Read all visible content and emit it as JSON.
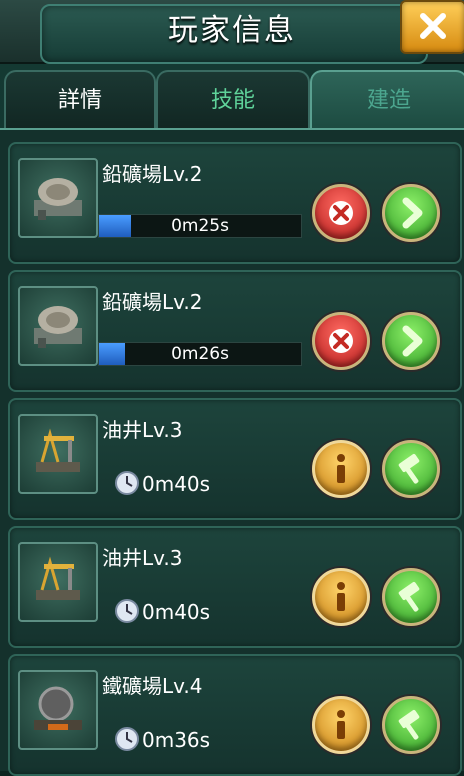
{
  "header": {
    "title": "玩家信息"
  },
  "tabs": [
    {
      "label": "詳情"
    },
    {
      "label": "技能"
    },
    {
      "label": "建造"
    }
  ],
  "colors": {
    "accent_gold": "#f5b02b",
    "progress_blue": "#2f7fe8",
    "cancel_red": "#d43a32",
    "confirm_green": "#4ec23a"
  },
  "buildings": [
    {
      "name": "鉛礦場Lv.2",
      "time": "0m25s",
      "progress": 0.16,
      "icon": "mine-machine-icon",
      "actions": [
        "cancel-icon",
        "speed-up-icon"
      ]
    },
    {
      "name": "鉛礦場Lv.2",
      "time": "0m26s",
      "progress": 0.13,
      "icon": "mine-machine-icon",
      "actions": [
        "cancel-icon",
        "speed-up-icon"
      ]
    },
    {
      "name": "油井Lv.3",
      "time": "0m40s",
      "icon": "oil-well-icon",
      "actions": [
        "info-icon",
        "build-hammer-icon"
      ]
    },
    {
      "name": "油井Lv.3",
      "time": "0m40s",
      "icon": "oil-well-icon",
      "actions": [
        "info-icon",
        "build-hammer-icon"
      ]
    },
    {
      "name": "鐵礦場Lv.4",
      "time": "0m36s",
      "icon": "iron-mine-icon",
      "actions": [
        "info-icon",
        "build-hammer-icon"
      ]
    }
  ]
}
